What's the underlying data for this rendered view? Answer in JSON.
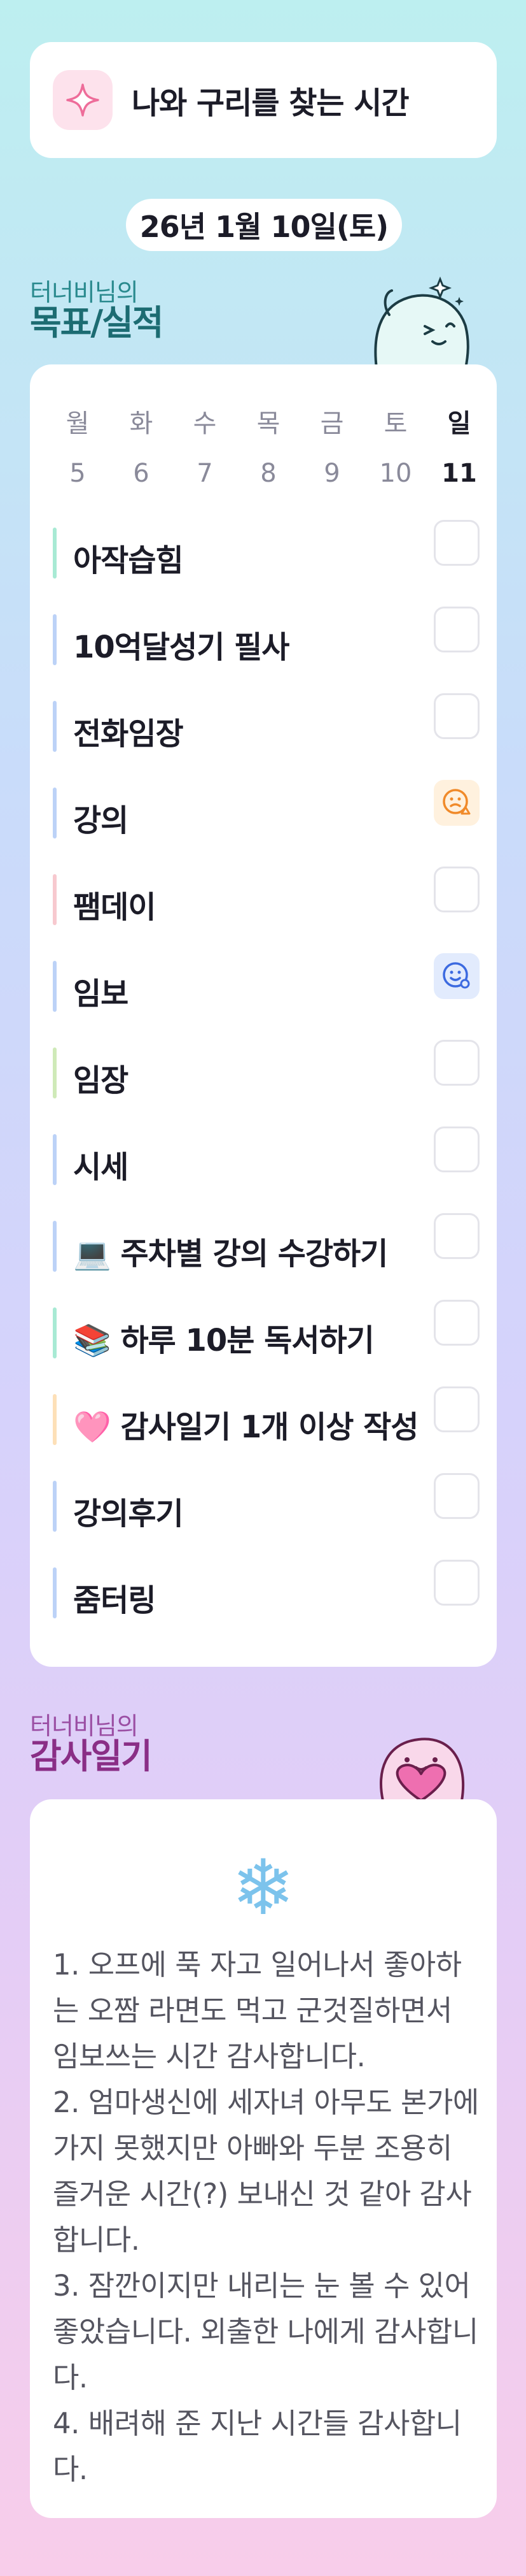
{
  "header": {
    "title": "나와 구리를 찾는 시간",
    "icon": "sparkle-icon"
  },
  "date": "26년 1월 10일(토)",
  "goals_section": {
    "subtitle": "터너비님의",
    "title": "목표/실적"
  },
  "week": [
    {
      "name": "월",
      "date": "5"
    },
    {
      "name": "화",
      "date": "6"
    },
    {
      "name": "수",
      "date": "7"
    },
    {
      "name": "목",
      "date": "8"
    },
    {
      "name": "금",
      "date": "9"
    },
    {
      "name": "토",
      "date": "10"
    },
    {
      "name": "일",
      "date": "11",
      "today": true
    }
  ],
  "goals": [
    {
      "label": "아작습힘",
      "color": "#a8ead4",
      "checked": false
    },
    {
      "label": "10억달성기 필사",
      "color": "#bcd2f7",
      "checked": false
    },
    {
      "label": "전화임장",
      "color": "#bcd2f7",
      "checked": false
    },
    {
      "label": "강의",
      "color": "#bcd2f7",
      "checked": true,
      "mark": "orange-face-icon"
    },
    {
      "label": "팸데이",
      "color": "#f7c9cf",
      "checked": false
    },
    {
      "label": "임보",
      "color": "#bcd2f7",
      "checked": true,
      "mark": "blue-face-icon"
    },
    {
      "label": "임장",
      "color": "#cfeab8",
      "checked": false
    },
    {
      "label": "시세",
      "color": "#bcd2f7",
      "checked": false
    },
    {
      "label": "💻 주차별 강의 수강하기",
      "color": "#bcd2f7",
      "checked": false
    },
    {
      "label": "📚 하루 10분 독서하기",
      "color": "#a8ead4",
      "checked": false
    },
    {
      "label": "🩷 감사일기 1개 이상 작성",
      "color": "#fde0b8",
      "checked": false
    },
    {
      "label": "강의후기",
      "color": "#bcd2f7",
      "checked": false
    },
    {
      "label": "줌터링",
      "color": "#bcd2f7",
      "checked": false
    }
  ],
  "thanks_section": {
    "subtitle": "터너비님의",
    "title": "감사일기",
    "icon": "snowflake-icon"
  },
  "diary": [
    "1. 오프에 푹 자고 일어나서 좋아하는 오짬 라면도 먹고 군것질하면서 임보쓰는 시간 감사합니다.",
    "2. 엄마생신에 세자녀 아무도 본가에 가지 못했지만 아빠와 두분 조용히 즐거운 시간(?) 보내신 것 같아 감사합니다.",
    "3. 잠깐이지만 내리는 눈 볼 수 있어 좋았습니다. 외출한 나에게 감사합니다.",
    "4. 배려해 준 지난 시간들 감사합니다."
  ]
}
